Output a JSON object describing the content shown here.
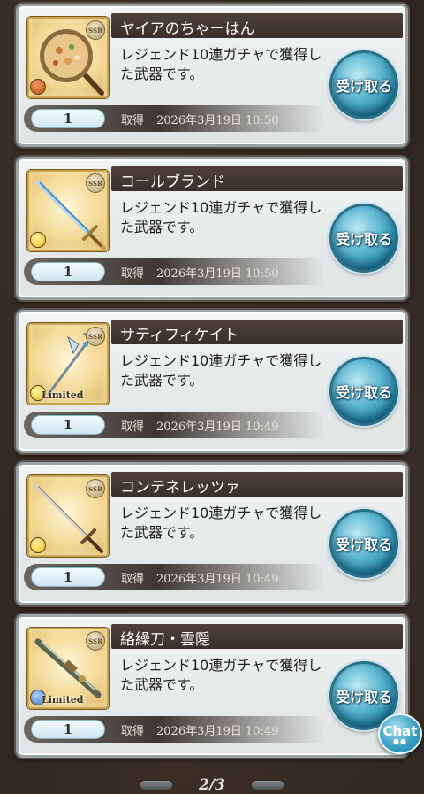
{
  "items": [
    {
      "name": "ヤイアのちゃーはん",
      "description": "レジェンド10連ガチャで獲得した武器です。",
      "quantity": "1",
      "acquired_label": "取得",
      "acquired_date": "2026年3月19日 10:50",
      "receive_label": "受け取る",
      "rarity": "SSR",
      "element_color": "#b54a1c",
      "limited": null,
      "image": "chahan-pan"
    },
    {
      "name": "コールブランド",
      "description": "レジェンド10連ガチャで獲得した武器です。",
      "quantity": "1",
      "acquired_label": "取得",
      "acquired_date": "2026年3月19日 10:50",
      "receive_label": "受け取る",
      "rarity": "SSR",
      "element_color": "#e9c21c",
      "limited": null,
      "image": "sword"
    },
    {
      "name": "サティフィケイト",
      "description": "レジェンド10連ガチャで獲得した武器です。",
      "quantity": "1",
      "acquired_label": "取得",
      "acquired_date": "2026年3月19日 10:49",
      "receive_label": "受け取る",
      "rarity": "SSR",
      "element_color": "#e9c21c",
      "limited": "Limited",
      "image": "halberd"
    },
    {
      "name": "コンテネレッツァ",
      "description": "レジェンド10連ガチャで獲得した武器です。",
      "quantity": "1",
      "acquired_label": "取得",
      "acquired_date": "2026年3月19日 10:49",
      "receive_label": "受け取る",
      "rarity": "SSR",
      "element_color": "#e9c21c",
      "limited": null,
      "image": "long-sword"
    },
    {
      "name": "絡繰刀・雲隠",
      "description": "レジェンド10連ガチャで獲得した武器です。",
      "quantity": "1",
      "acquired_label": "取得",
      "acquired_date": "2026年3月19日 10:49",
      "receive_label": "受け取る",
      "rarity": "SSR",
      "element_color": "#3a78c9",
      "limited": "Limited",
      "image": "mechanical-katana"
    }
  ],
  "chat_label": "Chat",
  "pager": {
    "text": "2/3"
  }
}
